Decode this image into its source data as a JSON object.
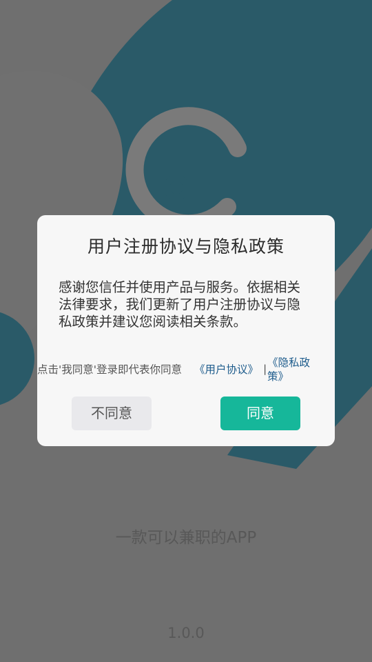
{
  "dialog": {
    "title": "用户注册协议与隐私政策",
    "body": "感谢您信任并使用产品与服务。依据相关法律要求，我们更新了用户注册协议与隐私政策并建议您阅读相关条款。",
    "consent_prefix": "点击'我同意'登录即代表你同意",
    "user_agreement_link": "《用户协议》",
    "separator": "|",
    "privacy_policy_link": "《隐私政策》",
    "disagree_label": "不同意",
    "agree_label": "同意"
  },
  "splash": {
    "slogan": "一款可以兼职的APP",
    "version": "1.0.0"
  },
  "colors": {
    "accent": "#16b79a",
    "link": "#1e5c8c",
    "brand_teal": "#2a5a68"
  },
  "icons": {
    "logo": "cat-logo"
  }
}
